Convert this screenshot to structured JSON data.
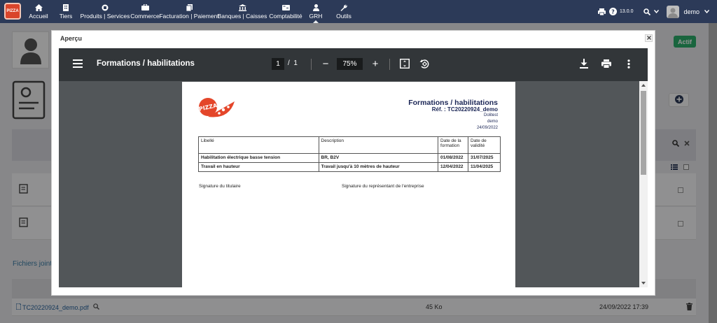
{
  "topnav": {
    "logo_text": "PIZZA",
    "items": [
      {
        "label": "Accueil",
        "icon": "home-icon"
      },
      {
        "label": "Tiers",
        "icon": "building-icon"
      },
      {
        "label": "Produits | Services",
        "icon": "cube-icon"
      },
      {
        "label": "Commerce",
        "icon": "briefcase-icon"
      },
      {
        "label": "Facturation | Paiement",
        "icon": "file-invoice-icon"
      },
      {
        "label": "Banques | Caisses",
        "icon": "bank-icon"
      },
      {
        "label": "Comptabilité",
        "icon": "calculator-icon"
      },
      {
        "label": "GRH",
        "icon": "user-icon"
      },
      {
        "label": "Outils",
        "icon": "wrench-icon"
      }
    ],
    "active_item": "GRH",
    "version": "13.0.0",
    "username": "demo"
  },
  "background": {
    "status_badge": "Actif",
    "fichiers_joints_label": "Fichiers joints",
    "file": {
      "name": "TC20220924_demo.pdf",
      "size": "45 Ko",
      "date": "24/09/2022 17:39"
    }
  },
  "modal": {
    "title": "Aperçu",
    "viewer": {
      "doc_title": "Formations / habilitations",
      "current_page": "1",
      "total_pages": "1",
      "page_separator": "/",
      "zoom": "75%",
      "zoom_out": "−",
      "zoom_in": "+"
    },
    "pdf": {
      "logo_text": "PIZZA",
      "heading": "Formations / habilitations",
      "reference": "Réf. : TC20220924_demo",
      "company": "Dolitest",
      "user": "demo",
      "date": "24/09/2022",
      "columns": [
        "Libellé",
        "Description",
        "Date de la formation",
        "Date de validité"
      ],
      "rows": [
        {
          "libelle": "Habilitation électrique basse tension",
          "description": "BR, B2V",
          "date_formation": "01/08/2022",
          "date_validite": "31/07/2025"
        },
        {
          "libelle": "Travail en hauteur",
          "description": "Travail jusqu'à 10 mètres de hauteur",
          "date_formation": "12/04/2022",
          "date_validite": "11/04/2025"
        }
      ],
      "signature_holder": "Signature du titulaire",
      "signature_company": "Signature du représentant de l'entreprise"
    }
  },
  "colors": {
    "navbar": "#2c3a58",
    "viewer_toolbar": "#323639",
    "viewer_bg": "#525659",
    "badge_green": "#2bae6b",
    "pdf_heading": "#1b2656",
    "logo_red": "#d9452b"
  }
}
